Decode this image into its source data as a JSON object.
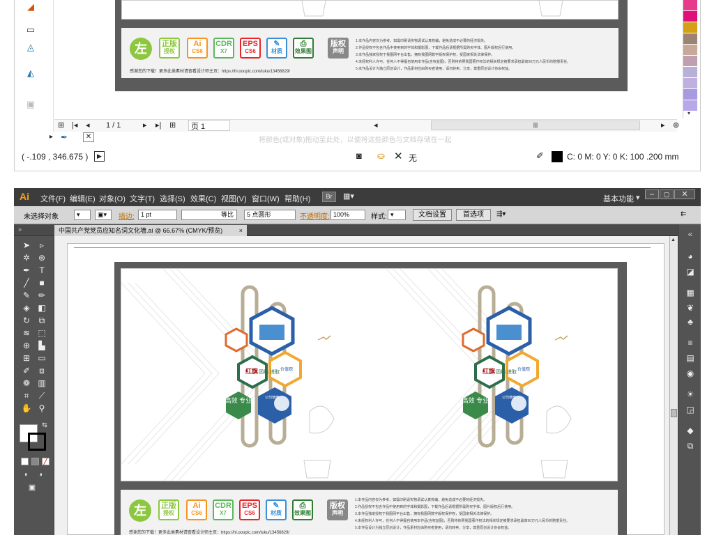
{
  "corel": {
    "page_counter": "1 / 1",
    "page_tab": "页 1",
    "coordinates": "( -.109 , 346.675 )",
    "fill_none": "无",
    "outline": "C: 0 M: 0 Y: 0 K: 100  .200 mm",
    "scroll_handle": "|||",
    "hint_watermark": "将颜色(或对象)拖动至此处，以便将这些颜色与文档存储在一起",
    "palette": [
      "#e63b8b",
      "#e0107a",
      "#d4a017",
      "#9c8373",
      "#c8a89a",
      "#c0a0b0",
      "#b8b0d8",
      "#c0b0e0",
      "#a89ae0",
      "#b8a8e8"
    ]
  },
  "illustrator": {
    "app_logo": "Ai",
    "menus": [
      "文件(F)",
      "编辑(E)",
      "对象(O)",
      "文字(T)",
      "选择(S)",
      "效果(C)",
      "视图(V)",
      "窗口(W)",
      "帮助(H)"
    ],
    "bridge": "Br",
    "workspace": "基本功能",
    "control": {
      "selection": "未选择对象",
      "stroke_label": "描边:",
      "stroke_value": "1 pt",
      "line_style": "等比",
      "brush": "5 点圆形",
      "opacity_label": "不透明度:",
      "opacity_value": "100%",
      "style_label": "样式:",
      "doc_settings": "文档设置",
      "preferences": "首选项"
    },
    "doc_tab": "中国共产党党员应知名词文化墙.ai @ 66.67% (CMYK/预览)",
    "doc_tab_close": "×"
  },
  "artwork": {
    "zuo": "左",
    "badges": [
      {
        "top": "正版",
        "bottom": "授权",
        "color": "#8dc63f"
      },
      {
        "top": "Ai",
        "bottom": "CS6",
        "color": "#f7941d"
      },
      {
        "top": "CDR",
        "bottom": "X7",
        "color": "#5cb85c"
      },
      {
        "top": "EPS",
        "bottom": "CS6",
        "color": "#e8262a"
      },
      {
        "top": "✎",
        "bottom": "材质",
        "color": "#3a8fd6"
      },
      {
        "top": "⎙",
        "bottom": "效果图",
        "color": "#2e7d32"
      },
      {
        "top": "版权",
        "bottom": "声明",
        "color": "#888888"
      }
    ],
    "notes": "1.本作品内容仅为参考，如需印刷请实物调试认真校编，避免造成不必要的经济损失。\n2.作品授权不包含作品中使用到的字体和摄影图，下载作品后请根据所需购买字体、图片版权后行使用。\n3.本作品独家授权于我图网平台出售，拥有我图网数字版权保护权，受国家相关法律保护。\n4.未经权利人许可，任何人不得擅自使用本作品(含权益图)，否则将依照我国著作权法的相关规定被要求承担最高50万元人民币的赔偿责任。\n5.本作品设计为独立原创设计，作品素材应由购买者使用，请勿转卖、分享，尊重原创设计协会权益。",
    "thanks": "感谢您的下载！更多此类素材请查看设计师主页：https://hi.ooopic.com/tuku/13456829/",
    "hex_labels": {
      "gaoxiao": "高效\n专业",
      "tuanjie": "团结\n进取",
      "jiazhi": "价值观",
      "gongsi": "公司使命",
      "hongqi": "红旗"
    }
  }
}
